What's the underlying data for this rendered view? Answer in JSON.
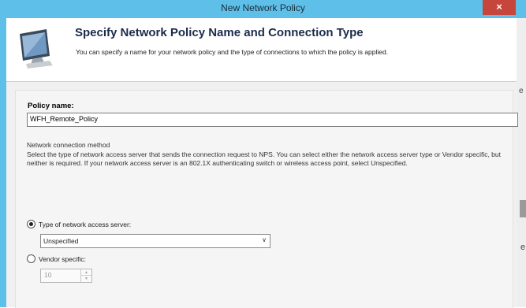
{
  "window": {
    "title": "New Network Policy",
    "close_glyph": "×"
  },
  "header": {
    "title": "Specify Network Policy Name and Connection Type",
    "description": "You can specify a name for your network policy and the type of connections to which the policy is applied.",
    "icon": "monitor-icon"
  },
  "form": {
    "policy_name_label": "Policy name:",
    "policy_name_value": "WFH_Remote_Policy",
    "connection_method_label": "Network connection method",
    "connection_method_description": "Select the type of network access server that sends the connection request to NPS. You can select either the network access server type or Vendor specific, but neither is required.  If your network access server is an 802.1X authenticating switch or wireless access point, select Unspecified.",
    "type_radio_label": "Type of network access server:",
    "type_radio_checked": true,
    "type_select_value": "Unspecified",
    "vendor_radio_label": "Vendor specific:",
    "vendor_radio_checked": false,
    "vendor_spinner_value": "10"
  },
  "background": {
    "text_fragment_1": "e",
    "text_fragment_2": "e"
  },
  "colors": {
    "titlebar": "#5ec0e8",
    "close_button": "#c7463b",
    "header_title": "#1b2b4a"
  }
}
